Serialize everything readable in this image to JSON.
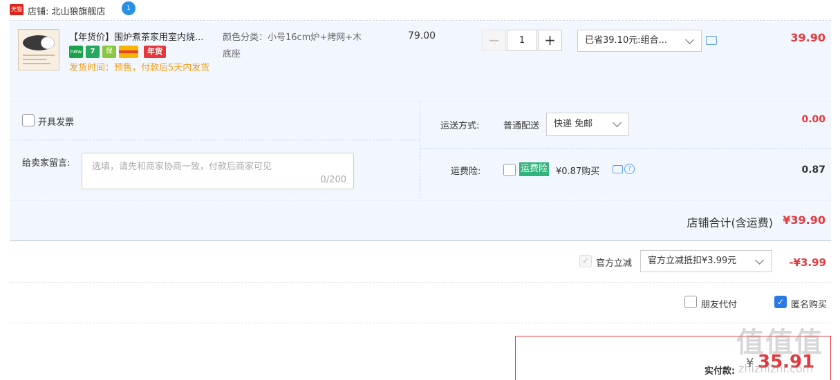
{
  "shop": {
    "badge": "天猫",
    "label": "店铺: 北山狼旗舰店",
    "chat_badge": "1"
  },
  "item": {
    "title": "【年货价】围炉煮茶家用室内烧...",
    "tags": [
      "new",
      "7",
      "保",
      "",
      "年货"
    ],
    "ship_time": "发货时间：预售，付款后5天内发货",
    "spec": "颜色分类：小号16cm炉+烤网+木底座",
    "unit_price": "79.00",
    "quantity": "1",
    "qty_minus": "−",
    "qty_plus": "+",
    "promo": "已省39.10元:组合...",
    "price": "39.90"
  },
  "options": {
    "invoice_label": "开具发票",
    "message_label": "给卖家留言:",
    "message_placeholder": "选填，请先和商家协商一致，付款后商家可见",
    "message_count": "0/200",
    "shipping_label": "运送方式:",
    "shipping_type": "普通配送",
    "shipping_select": "快递 免邮",
    "shipping_fee": "0.00",
    "insurance_label": "运费险:",
    "insurance_tag": "运费险",
    "insurance_price": "¥0.87购买",
    "insurance_help": "?",
    "insurance_fee": "0.87"
  },
  "shop_total": {
    "label": "店铺合计(含运费)",
    "value": "¥39.90"
  },
  "discount": {
    "label": "官方立减",
    "select": "官方立减抵扣¥3.99元",
    "value": "-¥3.99"
  },
  "extras": {
    "friend_pay": "朋友代付",
    "anonymous": "匿名购买"
  },
  "pay": {
    "label": "实付款:",
    "currency": "¥",
    "value": "35.91"
  },
  "watermark": {
    "logo": "值值值",
    "url": "zhizhizhi.com"
  },
  "colors": {
    "accent_red": "#e4393c",
    "panel_blue": "#f2f7ff",
    "checkbox_blue": "#2a7ae4",
    "insurance_green": "#2fb47a",
    "ship_time_orange": "#f39c12"
  }
}
